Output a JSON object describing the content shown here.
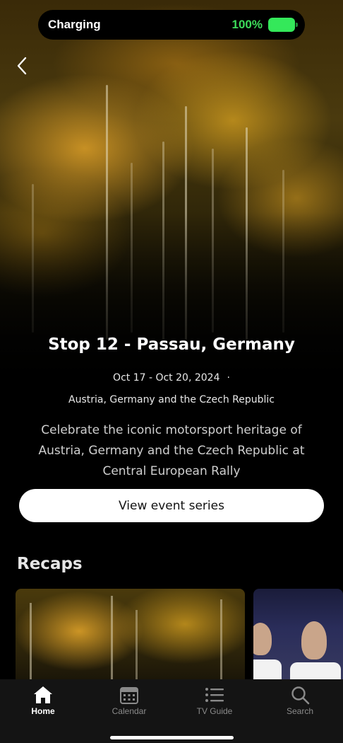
{
  "status_bar": {
    "charging_label": "Charging",
    "battery_percent": "100%",
    "battery_level": 1.0,
    "battery_color": "#34e85a"
  },
  "header": {
    "back_icon": "chevron-left-icon"
  },
  "event": {
    "title": "Stop 12 - Passau, Germany",
    "dates": "Oct 17 - Oct 20, 2024",
    "date_separator": "·",
    "location": "Austria, Germany and the Czech Republic",
    "description": "Celebrate the iconic motorsport heritage of Austria, Germany and the Czech Republic at Central European Rally",
    "cta_label": "View event series"
  },
  "recaps": {
    "title": "Recaps"
  },
  "tab_bar": {
    "items": [
      {
        "label": "Home",
        "icon": "home-icon",
        "active": true
      },
      {
        "label": "Calendar",
        "icon": "calendar-icon",
        "active": false
      },
      {
        "label": "TV Guide",
        "icon": "list-icon",
        "active": false
      },
      {
        "label": "Search",
        "icon": "search-icon",
        "active": false
      }
    ]
  }
}
